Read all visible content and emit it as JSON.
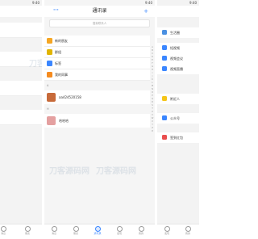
{
  "status": {
    "time": "9:40"
  },
  "contacts": {
    "title": "通讯录",
    "more_label": "···",
    "add_label": "+",
    "search_placeholder": "搜索联系人",
    "entries": [
      {
        "label": "新的朋友",
        "color": "#f5a623",
        "icon": "new-friend-icon"
      },
      {
        "label": "群组",
        "color": "#e1b400",
        "icon": "group-icon"
      },
      {
        "label": "标签",
        "color": "#3a86ff",
        "icon": "tag-icon"
      },
      {
        "label": "我的同事",
        "color": "#f58b1f",
        "icon": "colleague-icon"
      }
    ],
    "sections": [
      {
        "letter": "A",
        "contacts": [
          {
            "name": "aa424520158",
            "avatar_color": "#c76a3a"
          }
        ]
      },
      {
        "letter": "H",
        "contacts": [
          {
            "name": "哈哈哈",
            "avatar_color": "#e4a0a0"
          }
        ]
      }
    ],
    "index_letters": [
      "A",
      "B",
      "C",
      "D",
      "E",
      "F",
      "G",
      "H",
      "I",
      "J",
      "K",
      "L",
      "M",
      "N",
      "O",
      "P",
      "Q",
      "R",
      "S",
      "T",
      "U",
      "V",
      "W",
      "X",
      "Y",
      "Z",
      "#"
    ]
  },
  "discover": {
    "items": [
      {
        "label": "生活圈",
        "color": "#4a90e2",
        "icon": "moments-icon"
      },
      {
        "label": "短视频",
        "color": "#3a86ff",
        "icon": "short-video-icon"
      },
      {
        "label": "视频会议",
        "color": "#3a86ff",
        "icon": "video-meeting-icon"
      },
      {
        "label": "视频直播",
        "color": "#3a86ff",
        "icon": "live-icon"
      },
      {
        "label": "附近人",
        "color": "#f5c518",
        "icon": "nearby-icon"
      },
      {
        "label": "公众号",
        "color": "#3a86ff",
        "icon": "official-account-icon"
      },
      {
        "label": "签到红包",
        "color": "#e94e4e",
        "icon": "checkin-redpacket-icon"
      }
    ]
  },
  "tabbar": {
    "tabs": [
      {
        "label": "消息",
        "active": false
      },
      {
        "label": "朋友",
        "active": false
      },
      {
        "label": "通讯录",
        "active": true
      },
      {
        "label": "发现",
        "active": false
      },
      {
        "label": "我的",
        "active": false
      }
    ]
  },
  "left": {
    "time": "9:40",
    "watermark": "刀客源码网"
  },
  "right": {
    "time": "9:40"
  },
  "watermark": "刀客源码网"
}
